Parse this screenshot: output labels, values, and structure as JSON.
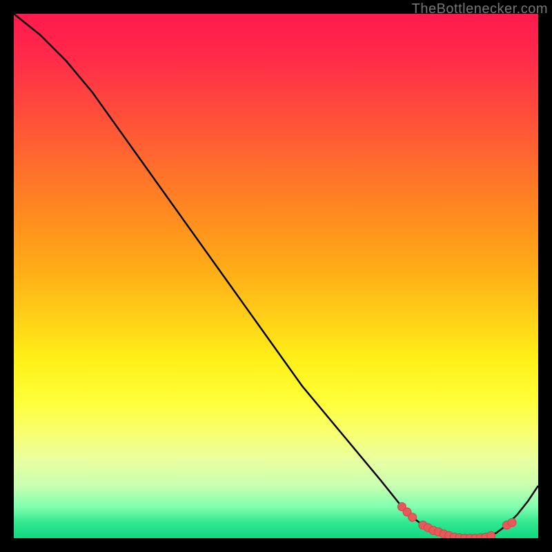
{
  "watermark": "TheBottlenecker.com",
  "colors": {
    "dot": "#e85a5a",
    "line": "#000000"
  },
  "chart_data": {
    "type": "line",
    "title": "",
    "xlabel": "",
    "ylabel": "",
    "xlim": [
      0,
      100
    ],
    "ylim": [
      0,
      100
    ],
    "grid": false,
    "legend": false,
    "series": [
      {
        "name": "curve",
        "x": [
          0,
          5,
          10,
          15,
          20,
          25,
          30,
          35,
          40,
          45,
          50,
          55,
          60,
          65,
          70,
          74,
          76,
          78,
          80,
          82,
          84,
          86,
          88,
          90,
          92,
          94,
          96,
          98,
          100
        ],
        "y": [
          100,
          96,
          91,
          85,
          78,
          71,
          64,
          57,
          50,
          43,
          36,
          29,
          23,
          17,
          11,
          6,
          4,
          2.5,
          1.5,
          0.8,
          0.2,
          0,
          0,
          0.2,
          1,
          2.5,
          4.5,
          7,
          10
        ]
      }
    ],
    "highlight_dots": {
      "name": "marked-points",
      "x": [
        74,
        75,
        76,
        78,
        79,
        80,
        81,
        82,
        83,
        84,
        85,
        86,
        87,
        88,
        89,
        90,
        91,
        94,
        95
      ],
      "y": [
        6,
        5,
        4,
        2.5,
        2,
        1.5,
        1.2,
        0.8,
        0.5,
        0.2,
        0.1,
        0,
        0,
        0,
        0.1,
        0.2,
        0.5,
        2.5,
        3
      ]
    }
  }
}
